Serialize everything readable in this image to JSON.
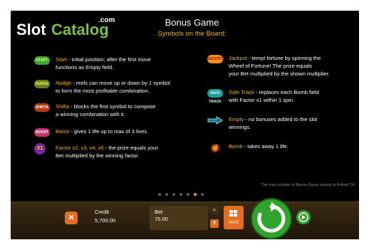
{
  "logo": {
    "slot": "Slot",
    "catalog": "Catalog",
    "com": ".com"
  },
  "header": {
    "title": "Bonus Game",
    "subtitle": "Symbols on the Board:"
  },
  "left_items": [
    {
      "icon_text": "START",
      "name": "Start",
      "desc": " - initial position; after the first move",
      "line2": "functions as Empty field."
    },
    {
      "icon_text": "NUDGE",
      "name": "Nudge",
      "desc": " - reels can move up or down by 1 symbol",
      "line2": "to form the most profitable combination."
    },
    {
      "icon_text": "SHIFTA",
      "name": "Shifta",
      "desc": " - blocks the first symbol to compose",
      "line2": "a winning combination with it."
    },
    {
      "icon_text": "BOOST",
      "name": "Boost",
      "desc": " - gives 1 life up to max of 3 lives.",
      "line2": ""
    },
    {
      "icon_text": "X1",
      "name": "Factor x2, x3, x4, x5",
      "desc": " - the prize equals your",
      "line2": "Bet multiplied by the winning factor."
    }
  ],
  "right_items": [
    {
      "icon_text": "JACKPOT",
      "name": "Jackpot",
      "desc": " - tempt fortune by spinning the",
      "line2": "Wheel of Fortune! The prize equals",
      "line3": "your Bet multiplied by the shown multiplier."
    },
    {
      "icon_text": "SAFE TRACK",
      "name": "Safe Track",
      "desc": " - replaces each Bomb field",
      "line2": "with Factor x1 within 1 spin.",
      "line3": ""
    },
    {
      "icon_text": "",
      "name": "Empty",
      "desc": " - no bonuses added to the slot",
      "line2": "winnings.",
      "line3": ""
    },
    {
      "icon_text": "",
      "name": "Bomb",
      "desc": " - takes away 1 life.",
      "line2": "",
      "line3": ""
    }
  ],
  "max_note": "The max number of Bonus Game rounds is limited: 50",
  "pagination": {
    "count": 7,
    "active_index": 5
  },
  "controls": {
    "close_symbol": "✕",
    "credit_label": "Credit",
    "credit_value": "5,700.00",
    "bet_label": "Bet",
    "bet_value": "75.00",
    "bet_up": "▲",
    "bet_down": "▼",
    "max_label": "MAX"
  },
  "colors": {
    "accent": "#f5b400",
    "brand_green": "#7ac143",
    "button_orange": "#e46d21",
    "spin_green": "#2fa32c"
  }
}
